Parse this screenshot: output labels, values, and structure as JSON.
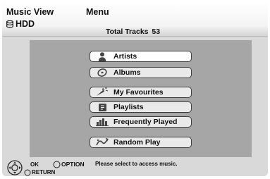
{
  "header": {
    "view_title": "Music View",
    "drive_label": "HDD",
    "menu_title": "Menu",
    "total_label": "Total Tracks",
    "total_value": "53"
  },
  "menu": {
    "items": [
      {
        "label": "Artists",
        "icon": "person-icon",
        "selected": true
      },
      {
        "label": "Albums",
        "icon": "disc-icon",
        "selected": false
      },
      {
        "label": "My Favourites",
        "icon": "favourite-icon",
        "selected": false
      },
      {
        "label": "Playlists",
        "icon": "playlist-icon",
        "selected": false
      },
      {
        "label": "Frequently Played",
        "icon": "frequently-played-icon",
        "selected": false
      },
      {
        "label": "Random Play",
        "icon": "random-play-icon",
        "selected": false
      }
    ]
  },
  "footer": {
    "ok_label": "OK",
    "return_label": "RETURN",
    "option_label": "OPTION",
    "hint": "Please select to access music."
  },
  "colors": {
    "panel": "#d9d9d9",
    "content": "#a6a6a6",
    "item": "#eaeaea",
    "item_selected": "#ffffff"
  }
}
